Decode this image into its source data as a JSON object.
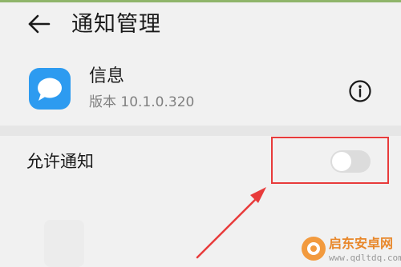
{
  "header": {
    "back_icon": "arrow-left-icon",
    "title": "通知管理"
  },
  "app": {
    "icon": "message-bubble-icon",
    "name": "信息",
    "version": "版本 10.1.0.320",
    "info_icon": "info-circle-icon"
  },
  "notifications": {
    "label": "允许通知",
    "toggle_state": "off"
  },
  "annotation": {
    "highlight_color": "#e83b3b",
    "arrow_color": "#e83b3b"
  },
  "watermark": {
    "name": "启东安卓网",
    "url": "www.qdltdq.com"
  },
  "colors": {
    "background": "#f1f1f1",
    "app_icon": "#2d9bf0",
    "toggle_off": "#dcdcdc"
  }
}
